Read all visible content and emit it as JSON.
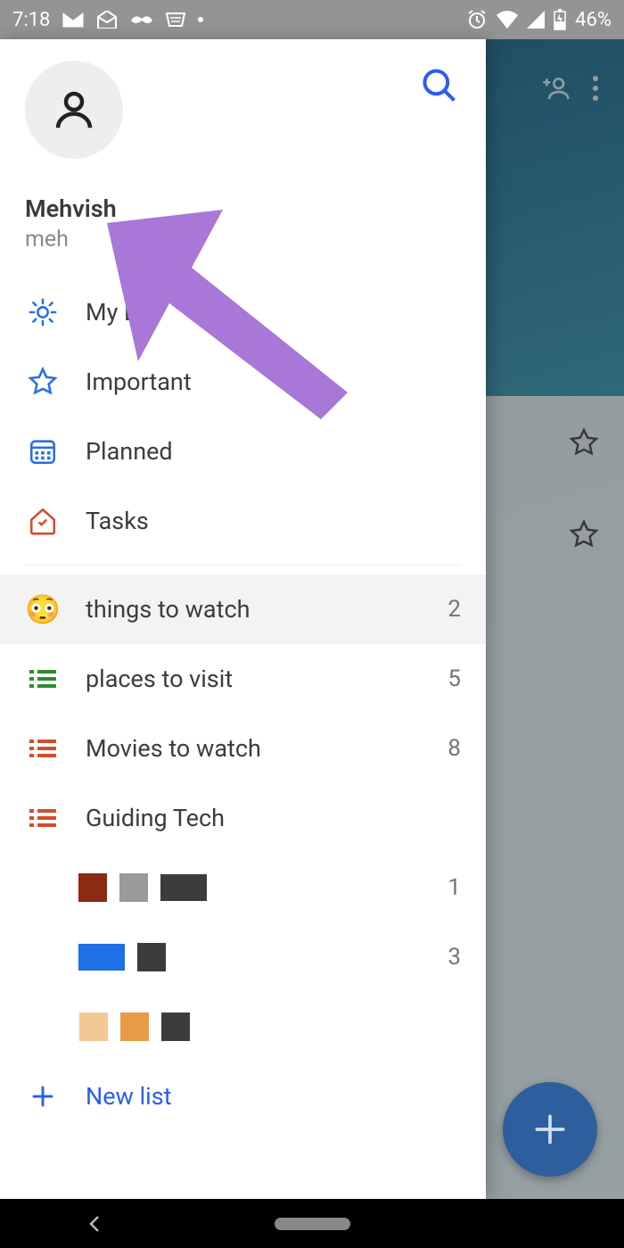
{
  "status": {
    "time": "7:18",
    "battery_pct": "46%"
  },
  "background": {
    "star_rows": [
      true,
      true
    ]
  },
  "profile": {
    "name": "Mehvish",
    "email": "meh"
  },
  "smart_lists": [
    {
      "id": "myday",
      "label": "My Day",
      "icon": "sun",
      "color": "#2a6fe0"
    },
    {
      "id": "important",
      "label": "Important",
      "icon": "star",
      "color": "#2a6fe0"
    },
    {
      "id": "planned",
      "label": "Planned",
      "icon": "calendar",
      "color": "#2a6fe0"
    },
    {
      "id": "tasks",
      "label": "Tasks",
      "icon": "home-check",
      "color": "#d14e2e"
    }
  ],
  "user_lists": [
    {
      "id": "watch",
      "label": "things to watch",
      "emoji": "😳",
      "count": "2",
      "icon_type": "emoji",
      "selected": true
    },
    {
      "id": "places",
      "label": "places to visit",
      "count": "5",
      "icon_type": "bullet",
      "bullet_color": "#2e8b2e"
    },
    {
      "id": "movies",
      "label": "Movies to watch",
      "count": "8",
      "icon_type": "bullet",
      "bullet_color": "#d14e2e"
    },
    {
      "id": "guidingtech",
      "label": "Guiding Tech",
      "count": "",
      "icon_type": "bullet",
      "bullet_color": "#d14e2e"
    },
    {
      "id": "colors1",
      "count": "1",
      "icon_type": "swatches",
      "swatches": [
        "#8a2a10",
        "#9a9a9a",
        "#3c3c3c",
        "#3c3c3c"
      ]
    },
    {
      "id": "colors2",
      "count": "3",
      "icon_type": "swatches",
      "swatches": [
        "#1f6fe6",
        "#3c3c3c"
      ]
    },
    {
      "id": "colors3",
      "count": "",
      "icon_type": "swatches",
      "swatches": [
        "#f2b771",
        "#d98a3a",
        "#3c3c3c"
      ]
    }
  ],
  "new_list_label": "New list",
  "colors": {
    "accent": "#2a5cf6",
    "fab": "#2d5f9e"
  }
}
